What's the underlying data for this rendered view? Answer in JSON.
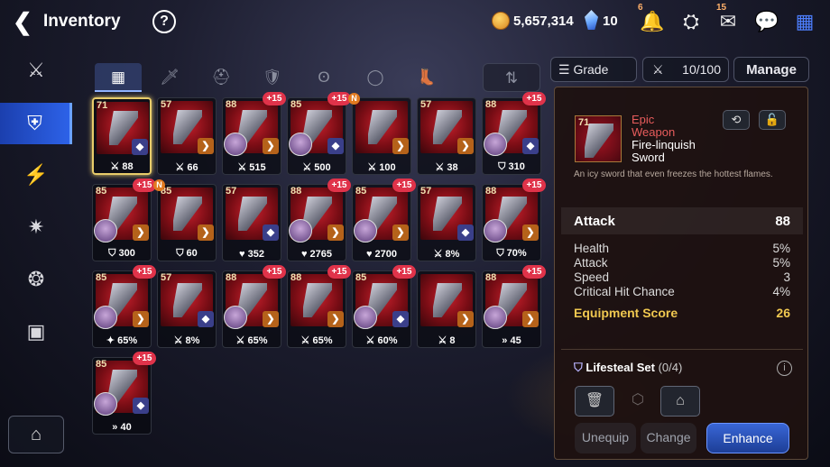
{
  "header": {
    "title": "Inventory",
    "gold": "5,657,314",
    "crystals": "10",
    "bell_badge": "6",
    "mail_badge": "15"
  },
  "icons": {
    "back": "back-arrow-icon",
    "help": "help-icon",
    "top": [
      "bell-icon",
      "friends-icon",
      "mail-icon",
      "chat-icon",
      "menu-grid-icon"
    ],
    "sidebar": [
      "equipment-icon",
      "shield-icon",
      "lightning-icon",
      "artifact-icon",
      "catalyst-icon",
      "chest-icon"
    ]
  },
  "tabs": {
    "all_label": "▦",
    "weapon_label": "🗡",
    "helm_label": "⛑",
    "armor_label": "🛡",
    "necklace_label": "ʘ",
    "ring_label": "◯",
    "boots_label": "👢",
    "sort_label": "⇅"
  },
  "filter": {
    "grade_label": "Grade",
    "capacity": "10/100",
    "manage_label": "Manage"
  },
  "items": [
    {
      "level": "71",
      "plus": "",
      "new": false,
      "stat": "88",
      "stat_icon": "⚔",
      "hero": false,
      "selected": true
    },
    {
      "level": "57",
      "plus": "",
      "new": false,
      "stat": "66",
      "stat_icon": "⚔",
      "hero": false
    },
    {
      "level": "88",
      "plus": "+15",
      "new": false,
      "stat": "515",
      "stat_icon": "⚔",
      "hero": true
    },
    {
      "level": "85",
      "plus": "+15",
      "new": false,
      "stat": "500",
      "stat_icon": "⚔",
      "hero": true
    },
    {
      "level": "",
      "plus": "",
      "new": true,
      "stat": "100",
      "stat_icon": "⚔",
      "hero": false
    },
    {
      "level": "57",
      "plus": "",
      "new": false,
      "stat": "38",
      "stat_icon": "⚔",
      "hero": false
    },
    {
      "level": "88",
      "plus": "+15",
      "new": false,
      "stat": "310",
      "stat_icon": "⛉",
      "hero": true
    },
    {
      "level": "85",
      "plus": "+15",
      "new": false,
      "stat": "300",
      "stat_icon": "⛉",
      "hero": true
    },
    {
      "level": "85",
      "plus": "",
      "new": true,
      "stat": "60",
      "stat_icon": "⛉",
      "hero": false
    },
    {
      "level": "57",
      "plus": "",
      "new": false,
      "stat": "352",
      "stat_icon": "♥",
      "hero": false
    },
    {
      "level": "88",
      "plus": "+15",
      "new": false,
      "stat": "2765",
      "stat_icon": "♥",
      "hero": true
    },
    {
      "level": "85",
      "plus": "+15",
      "new": false,
      "stat": "2700",
      "stat_icon": "♥",
      "hero": true
    },
    {
      "level": "57",
      "plus": "",
      "new": false,
      "stat": "8%",
      "stat_icon": "⚔",
      "hero": false
    },
    {
      "level": "88",
      "plus": "+15",
      "new": false,
      "stat": "70%",
      "stat_icon": "⛉",
      "hero": true
    },
    {
      "level": "85",
      "plus": "+15",
      "new": false,
      "stat": "65%",
      "stat_icon": "✦",
      "hero": true
    },
    {
      "level": "57",
      "plus": "",
      "new": false,
      "stat": "8%",
      "stat_icon": "⚔",
      "hero": false
    },
    {
      "level": "88",
      "plus": "+15",
      "new": false,
      "stat": "65%",
      "stat_icon": "⚔",
      "hero": true
    },
    {
      "level": "88",
      "plus": "+15",
      "new": false,
      "stat": "65%",
      "stat_icon": "⚔",
      "hero": false
    },
    {
      "level": "85",
      "plus": "+15",
      "new": false,
      "stat": "60%",
      "stat_icon": "⚔",
      "hero": true
    },
    {
      "level": "",
      "plus": "",
      "new": false,
      "stat": "8",
      "stat_icon": "⚔",
      "hero": false
    },
    {
      "level": "88",
      "plus": "+15",
      "new": false,
      "stat": "45",
      "stat_icon": "»",
      "hero": true
    },
    {
      "level": "85",
      "plus": "+15",
      "new": false,
      "stat": "40",
      "stat_icon": "»",
      "hero": true
    }
  ],
  "detail": {
    "level": "71",
    "grade": "Epic\nWeapon",
    "name": "Fire-linquish\nSword",
    "description": "An icy sword that even freezes the hottest flames.",
    "main_stat": {
      "label": "Attack",
      "value": "88"
    },
    "substats": [
      {
        "label": "Health",
        "value": "5%"
      },
      {
        "label": "Attack",
        "value": "5%"
      },
      {
        "label": "Speed",
        "value": "3"
      },
      {
        "label": "Critical Hit Chance",
        "value": "4%"
      }
    ],
    "score_label": "Equipment Score",
    "score_value": "26",
    "set_name": "Lifesteal Set",
    "set_count": "(0/4)",
    "unequip_label": "Unequip",
    "change_label": "Change",
    "enhance_label": "Enhance"
  },
  "colors": {
    "accent_blue": "#2d62e8",
    "epic_red": "#e85c5c",
    "score_gold": "#f0c850",
    "plus_badge": "#e0334a"
  }
}
